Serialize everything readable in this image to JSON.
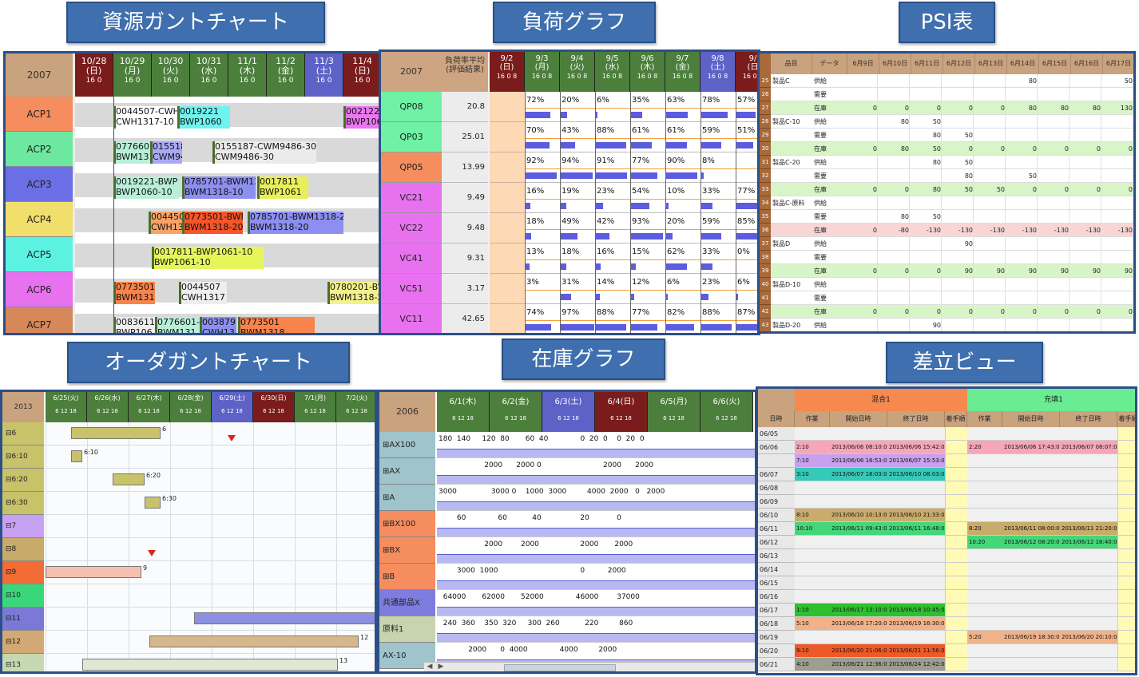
{
  "banners": {
    "resource_gantt": "資源ガントチャート",
    "load_graph": "負荷グラフ",
    "psi": "PSI表",
    "order_gantt": "オーダガントチャート",
    "stock_graph": "在庫グラフ",
    "diff_view": "差立ビュー"
  },
  "resource_gantt": {
    "year": "2007",
    "dates": [
      {
        "date": "10/28",
        "dow": "(日)"
      },
      {
        "date": "10/29",
        "dow": "(月)"
      },
      {
        "date": "10/30",
        "dow": "(火)"
      },
      {
        "date": "10/31",
        "dow": "(水)"
      },
      {
        "date": "11/1",
        "dow": "(木)"
      },
      {
        "date": "11/2",
        "dow": "(金)"
      },
      {
        "date": "11/3",
        "dow": "(土)"
      },
      {
        "date": "11/4",
        "dow": "(日)"
      }
    ],
    "hours": "16  0",
    "rows": [
      "ACP1",
      "ACP2",
      "ACP3",
      "ACP4",
      "ACP5",
      "ACP6",
      "ACP7"
    ],
    "bars": [
      {
        "row": 0,
        "text": "0044507-CWH\nCWH1317-10"
      },
      {
        "row": 0,
        "text": "0019221\nBWP1060"
      },
      {
        "row": 0,
        "text": "0021221\nBWP106"
      },
      {
        "row": 1,
        "text": "0776601\nBWM131"
      },
      {
        "row": 1,
        "text": "0155187-CW\nCWM9486-1"
      },
      {
        "row": 1,
        "text": "0155187-CWM9486-30\nCWM9486-30"
      },
      {
        "row": 2,
        "text": "0019221-BWP\nBWP1060-10"
      },
      {
        "row": 2,
        "text": "0785701-BWM13\nBWM1318-10"
      },
      {
        "row": 2,
        "text": "0017811\nBWP1061"
      },
      {
        "row": 3,
        "text": "00445C\nCWH13"
      },
      {
        "row": 3,
        "text": "0773501-BWM\nBWM1318-20"
      },
      {
        "row": 3,
        "text": "0785701-BWM1318-20\nBWM1318-20"
      },
      {
        "row": 4,
        "text": "0017811-BWP1061-10\nBWP1061-10"
      },
      {
        "row": 5,
        "text": "0773501-BWM\nBWM1318-10"
      },
      {
        "row": 5,
        "text": "0044507\nCWH1317"
      },
      {
        "row": 5,
        "text": "0780201-BW\nBWM1318-20"
      },
      {
        "row": 6,
        "text": "0083611-\nBWP106"
      },
      {
        "row": 6,
        "text": "0776601-\nBWM131"
      },
      {
        "row": 6,
        "text": "003879\nCWH13"
      },
      {
        "row": 6,
        "text": "0773501\nBWM1318"
      }
    ]
  },
  "load_graph": {
    "year": "2007",
    "col_header": "負荷率平均(評価結果)",
    "dates": [
      {
        "date": "9/2",
        "dow": "(日)"
      },
      {
        "date": "9/3",
        "dow": "(月)"
      },
      {
        "date": "9/4",
        "dow": "(火)"
      },
      {
        "date": "9/5",
        "dow": "(水)"
      },
      {
        "date": "9/6",
        "dow": "(木)"
      },
      {
        "date": "9/7",
        "dow": "(金)"
      },
      {
        "date": "9/8",
        "dow": "(土)"
      },
      {
        "date": "9/",
        "dow": "(日"
      }
    ],
    "hours": "16  0  8",
    "rows": [
      {
        "name": "QP08",
        "avg": "20.8",
        "pcts": [
          "72%",
          "20%",
          "6%",
          "35%",
          "63%",
          "78%",
          "57%"
        ],
        "fill": [
          0.72,
          0.2,
          0.06,
          0.35,
          0.63,
          0.78,
          0.57
        ]
      },
      {
        "name": "QP03",
        "avg": "25.01",
        "pcts": [
          "70%",
          "43%",
          "88%",
          "61%",
          "61%",
          "59%",
          "51%"
        ],
        "fill": [
          0.7,
          0.43,
          0.88,
          0.61,
          0.61,
          0.59,
          0.51
        ]
      },
      {
        "name": "QP05",
        "avg": "13.99",
        "pcts": [
          "92%",
          "94%",
          "91%",
          "77%",
          "90%",
          "8%",
          ""
        ],
        "fill": [
          0.92,
          0.94,
          0.91,
          0.77,
          0.9,
          0.08,
          0
        ]
      },
      {
        "name": "VC21",
        "avg": "9.49",
        "pcts": [
          "16%",
          "19%",
          "23%",
          "54%",
          "10%",
          "33%",
          "77%"
        ],
        "fill": [
          0.16,
          0.19,
          0.23,
          0.54,
          0.1,
          0.33,
          0.77
        ]
      },
      {
        "name": "VC22",
        "avg": "9.48",
        "pcts": [
          "18%",
          "49%",
          "42%",
          "93%",
          "20%",
          "59%",
          "85%"
        ],
        "fill": [
          0.18,
          0.49,
          0.42,
          0.93,
          0.2,
          0.59,
          0.85
        ]
      },
      {
        "name": "VC41",
        "avg": "9.31",
        "pcts": [
          "13%",
          "18%",
          "16%",
          "15%",
          "62%",
          "33%",
          "0%"
        ],
        "fill": [
          0.13,
          0.18,
          0.16,
          0.15,
          0.62,
          0.33,
          0
        ]
      },
      {
        "name": "VC51",
        "avg": "3.17",
        "pcts": [
          "3%",
          "31%",
          "14%",
          "12%",
          "6%",
          "23%",
          "6%"
        ],
        "fill": [
          0.03,
          0.31,
          0.14,
          0.12,
          0.06,
          0.23,
          0.06
        ]
      },
      {
        "name": "VC11",
        "avg": "42.65",
        "pcts": [
          "74%",
          "97%",
          "88%",
          "77%",
          "82%",
          "88%",
          "87%"
        ],
        "fill": [
          0.74,
          0.97,
          0.88,
          0.77,
          0.82,
          0.88,
          0.87
        ]
      }
    ]
  },
  "psi": {
    "headers": [
      "品目",
      "データ",
      "6月9日",
      "6月10日",
      "6月11日",
      "6月12日",
      "6月13日",
      "6月14日",
      "6月15日",
      "6月16日",
      "6月17日"
    ],
    "rows": [
      {
        "no": "25",
        "item": "製品C",
        "kind": "供給",
        "vals": [
          "",
          "",
          "",
          "",
          "",
          "80",
          "",
          "",
          "50"
        ]
      },
      {
        "no": "26",
        "item": "",
        "kind": "需要",
        "vals": [
          "",
          "",
          "",
          "",
          "",
          "",
          "",
          "",
          ""
        ]
      },
      {
        "no": "27",
        "item": "",
        "kind": "在庫",
        "vals": [
          "0",
          "0",
          "0",
          "0",
          "0",
          "80",
          "80",
          "80",
          "130"
        ],
        "stock": true
      },
      {
        "no": "28",
        "item": "製品C-10",
        "kind": "供給",
        "vals": [
          "",
          "80",
          "50",
          "",
          "",
          "",
          "",
          "",
          ""
        ]
      },
      {
        "no": "29",
        "item": "",
        "kind": "需要",
        "vals": [
          "",
          "",
          "80",
          "50",
          "",
          "",
          "",
          "",
          ""
        ]
      },
      {
        "no": "30",
        "item": "",
        "kind": "在庫",
        "vals": [
          "0",
          "80",
          "50",
          "0",
          "0",
          "0",
          "0",
          "0",
          "0"
        ],
        "stock": true
      },
      {
        "no": "31",
        "item": "製品C-20",
        "kind": "供給",
        "vals": [
          "",
          "",
          "80",
          "50",
          "",
          "",
          "",
          "",
          ""
        ]
      },
      {
        "no": "32",
        "item": "",
        "kind": "需要",
        "vals": [
          "",
          "",
          "",
          "80",
          "",
          "50",
          "",
          "",
          ""
        ]
      },
      {
        "no": "33",
        "item": "",
        "kind": "在庫",
        "vals": [
          "0",
          "0",
          "80",
          "50",
          "50",
          "0",
          "0",
          "0",
          "0"
        ],
        "stock": true
      },
      {
        "no": "34",
        "item": "製品C-原料",
        "kind": "供給",
        "vals": [
          "",
          "",
          "",
          "",
          "",
          "",
          "",
          "",
          ""
        ]
      },
      {
        "no": "35",
        "item": "",
        "kind": "需要",
        "vals": [
          "",
          "80",
          "50",
          "",
          "",
          "",
          "",
          "",
          ""
        ]
      },
      {
        "no": "36",
        "item": "",
        "kind": "在庫",
        "vals": [
          "0",
          "-80",
          "-130",
          "-130",
          "-130",
          "-130",
          "-130",
          "-130",
          "-130"
        ],
        "neg": true
      },
      {
        "no": "37",
        "item": "製品D",
        "kind": "供給",
        "vals": [
          "",
          "",
          "",
          "90",
          "",
          "",
          "",
          "",
          ""
        ]
      },
      {
        "no": "38",
        "item": "",
        "kind": "需要",
        "vals": [
          "",
          "",
          "",
          "",
          "",
          "",
          "",
          "",
          ""
        ]
      },
      {
        "no": "39",
        "item": "",
        "kind": "在庫",
        "vals": [
          "0",
          "0",
          "0",
          "90",
          "90",
          "90",
          "90",
          "90",
          "90"
        ],
        "stock": true
      },
      {
        "no": "40",
        "item": "製品D-10",
        "kind": "供給",
        "vals": [
          "",
          "",
          "",
          "",
          "",
          "",
          "",
          "",
          ""
        ]
      },
      {
        "no": "41",
        "item": "",
        "kind": "需要",
        "vals": [
          "",
          "",
          "",
          "",
          "",
          "",
          "",
          "",
          ""
        ]
      },
      {
        "no": "42",
        "item": "",
        "kind": "在庫",
        "vals": [
          "0",
          "0",
          "0",
          "0",
          "0",
          "0",
          "0",
          "0",
          "0"
        ],
        "stock": true
      },
      {
        "no": "43",
        "item": "製品D-20",
        "kind": "供給",
        "vals": [
          "",
          "",
          "90",
          "",
          "",
          "",
          "",
          "",
          ""
        ]
      }
    ]
  },
  "order_gantt": {
    "year": "2013",
    "dates": [
      "6/25(火)",
      "6/26(水)",
      "6/27(木)",
      "6/28(金)",
      "6/29(土)",
      "6/30(日)",
      "7/1(月)",
      "7/2(火)"
    ],
    "hours": "6  12  18",
    "rows": [
      {
        "label": "⊟6",
        "color": "#c8c36a"
      },
      {
        "label": "⊟6:10",
        "color": "#c8c36a"
      },
      {
        "label": "⊟6:20",
        "color": "#c8c36a"
      },
      {
        "label": "⊟6:30",
        "color": "#c8c36a"
      },
      {
        "label": "⊟7",
        "color": "#c7a2f2"
      },
      {
        "label": "⊟8",
        "color": "#c8aa6a"
      },
      {
        "label": "⊟9",
        "color": "#f26c35"
      },
      {
        "label": "⊟10",
        "color": "#3ad77a"
      },
      {
        "label": "⊟11",
        "color": "#7b79d6"
      },
      {
        "label": "⊟12",
        "color": "#d2a874"
      },
      {
        "label": "⊟13",
        "color": "#c6d8b2"
      }
    ],
    "bar_labels": [
      "6",
      "6:10",
      "6:20",
      "6:30",
      "9",
      "12",
      "13"
    ]
  },
  "stock_graph": {
    "year": "2006",
    "dates": [
      "6/1(木)",
      "6/2(金)",
      "6/3(土)",
      "6/4(日)",
      "6/5(月)",
      "6/6(火)"
    ],
    "hours": "6  12  18",
    "rows": [
      {
        "name": "⊞AX100",
        "labels": "180  140     120  80       60  40              0  20  0    0  20  0"
      },
      {
        "name": "⊞AX",
        "labels": "                    2000      2000 0                           2000      2000"
      },
      {
        "name": "⊞A",
        "labels": "3000               3000 0    1000  3000         4000  2000   0   2000"
      },
      {
        "name": "⊞BX100",
        "labels": "        60              60           40                 20            0"
      },
      {
        "name": "⊞BX",
        "labels": "                    2000        2000                  2000       2000"
      },
      {
        "name": "⊞B",
        "labels": "        3000  1000                                    0          2000"
      },
      {
        "name": "共通部品X",
        "labels": "  64000       62000       52000              46000        37000"
      },
      {
        "name": "原料1",
        "labels": "  240  360    350  320     300  260           220         860"
      },
      {
        "name": "AX-10",
        "labels": "             2000      0  4000              4000         2000"
      }
    ]
  },
  "diff_view": {
    "group1": "混合1",
    "group2": "充填1",
    "headers": [
      "日時",
      "作業",
      "開始日時",
      "終了日時",
      "着手順",
      "作業",
      "開始日時",
      "終了日時",
      "着手順"
    ],
    "rows": [
      {
        "d": "06/05",
        "a": [
          "",
          "",
          "",
          ""
        ],
        "b": [
          "",
          "",
          "",
          ""
        ],
        "ac": "",
        "bc": ""
      },
      {
        "d": "06/06",
        "a": [
          "2:10",
          "2013/06/06 08:10:00",
          "2013/06/06 15:42:00",
          ""
        ],
        "b": [
          "2:20",
          "2013/06/06 17:43:00",
          "2013/06/07 08:07:00",
          ""
        ],
        "ac": "#f6a6b8",
        "bc": "#f6a6b8"
      },
      {
        "d": "",
        "a": [
          "7:10",
          "2013/06/06 16:53:00",
          "2013/06/07 15:53:00",
          ""
        ],
        "b": [
          "",
          "",
          "",
          ""
        ],
        "ac": "#c9a0ee",
        "bc": ""
      },
      {
        "d": "06/07",
        "a": [
          "3:10",
          "2013/06/07 18:03:00",
          "2013/06/10 08:03:00",
          ""
        ],
        "b": [
          "",
          "",
          "",
          ""
        ],
        "ac": "#35c9b7",
        "bc": ""
      },
      {
        "d": "06/08",
        "a": [
          "",
          "",
          "",
          ""
        ],
        "b": [
          "",
          "",
          "",
          ""
        ],
        "ac": "",
        "bc": ""
      },
      {
        "d": "06/09",
        "a": [
          "",
          "",
          "",
          ""
        ],
        "b": [
          "",
          "",
          "",
          ""
        ],
        "ac": "",
        "bc": ""
      },
      {
        "d": "06/10",
        "a": [
          "8:10",
          "2013/06/10 10:13:00",
          "2013/06/10 21:33:00",
          ""
        ],
        "b": [
          "",
          "",
          "",
          ""
        ],
        "ac": "#c9ac6c",
        "bc": ""
      },
      {
        "d": "06/11",
        "a": [
          "10:10",
          "2013/06/11 09:43:00",
          "2013/06/11 16:48:00",
          ""
        ],
        "b": [
          "8:20",
          "2013/06/11 08:00:00",
          "2013/06/11 21:20:00",
          ""
        ],
        "ac": "#46d67a",
        "bc": "#c9ac6c"
      },
      {
        "d": "06/12",
        "a": [
          "",
          "",
          "",
          ""
        ],
        "b": [
          "10:20",
          "2013/06/12 08:20:00",
          "2013/06/12 16:40:00",
          ""
        ],
        "ac": "",
        "bc": "#46d67a"
      },
      {
        "d": "06/13",
        "a": [
          "",
          "",
          "",
          ""
        ],
        "b": [
          "",
          "",
          "",
          ""
        ],
        "ac": "",
        "bc": ""
      },
      {
        "d": "06/14",
        "a": [
          "",
          "",
          "",
          ""
        ],
        "b": [
          "",
          "",
          "",
          ""
        ],
        "ac": "",
        "bc": ""
      },
      {
        "d": "06/15",
        "a": [
          "",
          "",
          "",
          ""
        ],
        "b": [
          "",
          "",
          "",
          ""
        ],
        "ac": "",
        "bc": ""
      },
      {
        "d": "06/16",
        "a": [
          "",
          "",
          "",
          ""
        ],
        "b": [
          "",
          "",
          "",
          ""
        ],
        "ac": "",
        "bc": ""
      },
      {
        "d": "06/17",
        "a": [
          "1:10",
          "2013/06/17 13:10:00",
          "2013/06/18 10:45:00",
          ""
        ],
        "b": [
          "",
          "",
          "",
          ""
        ],
        "ac": "#2fc02f",
        "bc": ""
      },
      {
        "d": "06/18",
        "a": [
          "5:10",
          "2013/06/18 17:20:00",
          "2013/06/19 16:30:00",
          ""
        ],
        "b": [
          "",
          "",
          "",
          ""
        ],
        "ac": "#f1b289",
        "bc": ""
      },
      {
        "d": "06/19",
        "a": [
          "",
          "",
          "",
          ""
        ],
        "b": [
          "5:20",
          "2013/06/19 18:30:00",
          "2013/06/20 20:10:00",
          ""
        ],
        "ac": "",
        "bc": "#f1b289"
      },
      {
        "d": "06/20",
        "a": [
          "9:10",
          "2013/06/20 21:06:00",
          "2013/06/21 11:56:00",
          ""
        ],
        "b": [
          "",
          "",
          "",
          ""
        ],
        "ac": "#ee5a27",
        "bc": ""
      },
      {
        "d": "06/21",
        "a": [
          "4:10",
          "2013/06/21 12:36:00",
          "2013/06/24 12:42:00",
          ""
        ],
        "b": [
          "",
          "",
          "",
          ""
        ],
        "ac": "#9d9d90",
        "bc": ""
      }
    ]
  }
}
